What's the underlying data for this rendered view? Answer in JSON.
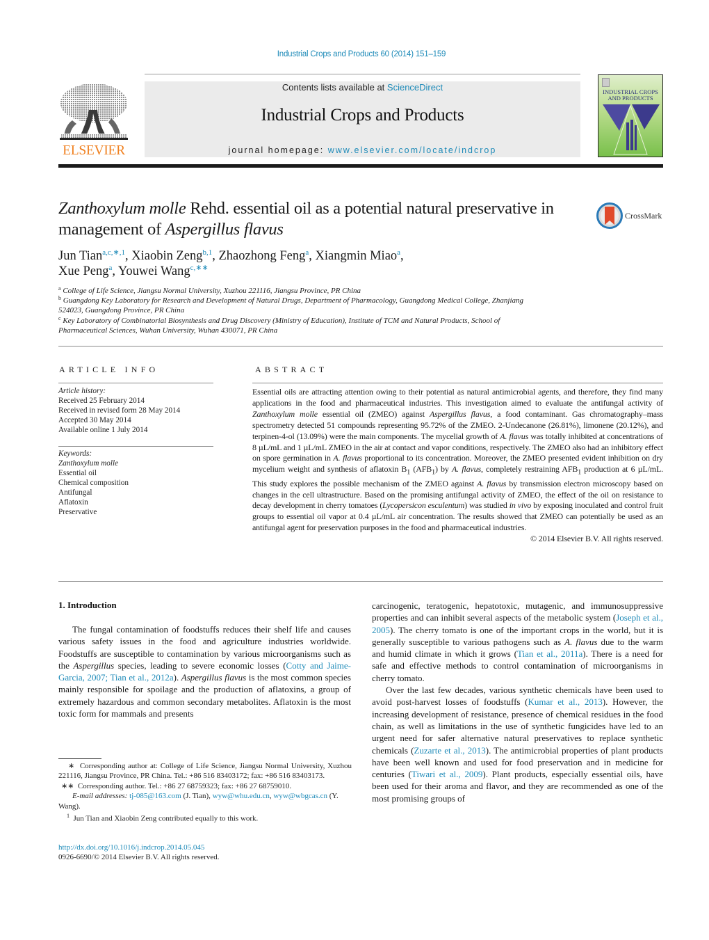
{
  "header": {
    "journal_ref": "Industrial Crops and Products 60 (2014) 151–159",
    "contents_prefix": "Contents lists available at ",
    "contents_link": "ScienceDirect",
    "journal_title": "Industrial Crops and Products",
    "homepage_prefix": "journal homepage: ",
    "homepage_url": "www.elsevier.com/locate/indcrop",
    "publisher_logo": "ELSEVIER",
    "cover_title": "INDUSTRIAL CROPS AND PRODUCTS",
    "crossmark_label": "CrossMark"
  },
  "article": {
    "title_italic_1": "Zanthoxylum molle",
    "title_plain_1": " Rehd. essential oil as a potential natural preservative in management of ",
    "title_italic_2": "Aspergillus flavus",
    "authors": [
      {
        "name": "Jun Tian",
        "sup": "a,c,∗,1",
        "sep": ", "
      },
      {
        "name": "Xiaobin Zeng",
        "sup": "b,1",
        "sep": ", "
      },
      {
        "name": "Zhaozhong Feng",
        "sup": "a",
        "sep": ", "
      },
      {
        "name": "Xiangmin Miao",
        "sup": "a",
        "sep": ","
      },
      {
        "name": "Xue Peng",
        "sup": "a",
        "sep": ", "
      },
      {
        "name": "Youwei Wang",
        "sup": "c,∗∗",
        "sep": ""
      }
    ],
    "affiliations": [
      {
        "key": "a",
        "text": "College of Life Science, Jiangsu Normal University, Xuzhou 221116, Jiangsu Province, PR China"
      },
      {
        "key": "b",
        "text": "Guangdong Key Laboratory for Research and Development of Natural Drugs, Department of Pharmacology, Guangdong Medical College, Zhanjiang 524023, Guangdong Province, PR China"
      },
      {
        "key": "c",
        "text": "Key Laboratory of Combinatorial Biosynthesis and Drug Discovery (Ministry of Education), Institute of TCM and Natural Products, School of Pharmaceutical Sciences, Wuhan University, Wuhan 430071, PR China"
      }
    ]
  },
  "article_info": {
    "heading": "ARTICLE INFO",
    "history_label": "Article history:",
    "history": [
      "Received 25 February 2014",
      "Received in revised form 28 May 2014",
      "Accepted 30 May 2014",
      "Available online 1 July 2014"
    ],
    "keywords_label": "Keywords:",
    "keywords": [
      "Zanthoxylum molle",
      "Essential oil",
      "Chemical composition",
      "Antifungal",
      "Aflatoxin",
      "Preservative"
    ]
  },
  "abstract": {
    "heading": "ABSTRACT",
    "parts": {
      "p1": "Essential oils are attracting attention owing to their potential as natural antimicrobial agents, and therefore, they find many applications in the food and pharmaceutical industries. This investigation aimed to evaluate the antifungal activity of ",
      "i1": "Zanthoxylum molle",
      "p2": " essential oil (ZMEO) against ",
      "i2": "Aspergillus flavus",
      "p3": ", a food contaminant. Gas chromatography–mass spectrometry detected 51 compounds representing 95.72% of the ZMEO. 2-Undecanone (26.81%), limonene (20.12%), and terpinen-4-ol (13.09%) were the main components. The mycelial growth of ",
      "i3": "A. flavus",
      "p4": " was totally inhibited at concentrations of 8 µL/mL and 1 µL/mL ZMEO in the air at contact and vapor conditions, respectively. The ZMEO also had an inhibitory effect on spore germination in ",
      "i4": "A. flavus",
      "p5": " proportional to its concentration. Moreover, the ZMEO presented evident inhibition on dry mycelium weight and synthesis of aflatoxin B",
      "sub1": "1",
      "p6": " (AFB",
      "sub2": "1",
      "p7": ") by ",
      "i5": "A. flavus",
      "p8": ", completely restraining AFB",
      "sub3": "1",
      "p9": " production at 6 µL/mL. This study explores the possible mechanism of the ZMEO against ",
      "i6": "A. flavus",
      "p10": " by transmission electron microscopy based on changes in the cell ultrastructure. Based on the promising antifungal activity of ZMEO, the effect of the oil on resistance to decay development in cherry tomatoes (",
      "i7": "Lycopersicon esculentum",
      "p11": ") was studied ",
      "i8": "in vivo",
      "p12": " by exposing inoculated and control fruit groups to essential oil vapor at 0.4 µL/mL air concentration. The results showed that ZMEO can potentially be used as an antifungal agent for preservation purposes in the food and pharmaceutical industries."
    },
    "copyright": "© 2014 Elsevier B.V. All rights reserved."
  },
  "introduction": {
    "heading": "1.  Introduction",
    "left": {
      "t1": "The fungal contamination of foodstuffs reduces their shelf life and causes various safety issues in the food and agriculture industries worldwide. Foodstuffs are susceptible to contamination by various microorganisms such as the ",
      "i1": "Aspergillus",
      "t2": " species, leading to severe economic losses (",
      "cite1": "Cotty and Jaime-Garcia, 2007; Tian et al., 2012a",
      "t3": "). ",
      "i2": "Aspergillus flavus",
      "t4": " is the most common species mainly responsible for spoilage and the production of aflatoxins, a group of extremely hazardous and common secondary metabolites. Aflatoxin is the most toxic form for mammals and presents"
    },
    "right_p1": {
      "t1": "carcinogenic, teratogenic, hepatotoxic, mutagenic, and immunosuppressive properties and can inhibit several aspects of the metabolic system (",
      "cite1": "Joseph et al., 2005",
      "t2": "). The cherry tomato is one of the important crops in the world, but it is generally susceptible to various pathogens such as ",
      "i1": "A. flavus",
      "t3": " due to the warm and humid climate in which it grows (",
      "cite2": "Tian et al., 2011a",
      "t4": "). There is a need for safe and effective methods to control contamination of microorganisms in cherry tomato."
    },
    "right_p2": {
      "t1": "Over the last few decades, various synthetic chemicals have been used to avoid post-harvest losses of foodstuffs (",
      "cite1": "Kumar et al., 2013",
      "t2": "). However, the increasing development of resistance, presence of chemical residues in the food chain, as well as limitations in the use of synthetic fungicides have led to an urgent need for safer alternative natural preservatives to replace synthetic chemicals (",
      "cite2": "Zuzarte et al., 2013",
      "t3": "). The antimicrobial properties of plant products have been well known and used for food preservation and in medicine for centuries (",
      "cite3": "Tiwari et al., 2009",
      "t4": "). Plant products, especially essential oils, have been used for their aroma and flavor, and they are recommended as one of the most promising groups of"
    }
  },
  "footnotes": {
    "fn1_mark": "∗",
    "fn1_text": "Corresponding author at: College of Life Science, Jiangsu Normal University, Xuzhou 221116, Jiangsu Province, PR China. Tel.: +86 516 83403172; fax: +86 516 83403173.",
    "fn2_mark": "∗∗",
    "fn2_text": "Corresponding author. Tel.: +86 27 68759323; fax: +86 27 68759010.",
    "email_label": "E-mail addresses:",
    "email1": "tj-085@163.com",
    "email1_owner": " (J. Tian), ",
    "email2": "wyw@whu.edu.cn",
    "email_sep": ", ",
    "email3": "wyw@wbgcas.cn",
    "email3_owner": " (Y. Wang).",
    "fn3_mark": "1",
    "fn3_text": "Jun Tian and Xiaobin Zeng contributed equally to this work."
  },
  "doi": {
    "url": "http://dx.doi.org/10.1016/j.indcrop.2014.05.045",
    "issn_line": "0926-6690/© 2014 Elsevier B.V. All rights reserved."
  },
  "colors": {
    "link": "#1d8ab8",
    "elsevier_orange": "#f0801f",
    "masthead_gray": "#ebebeb"
  }
}
